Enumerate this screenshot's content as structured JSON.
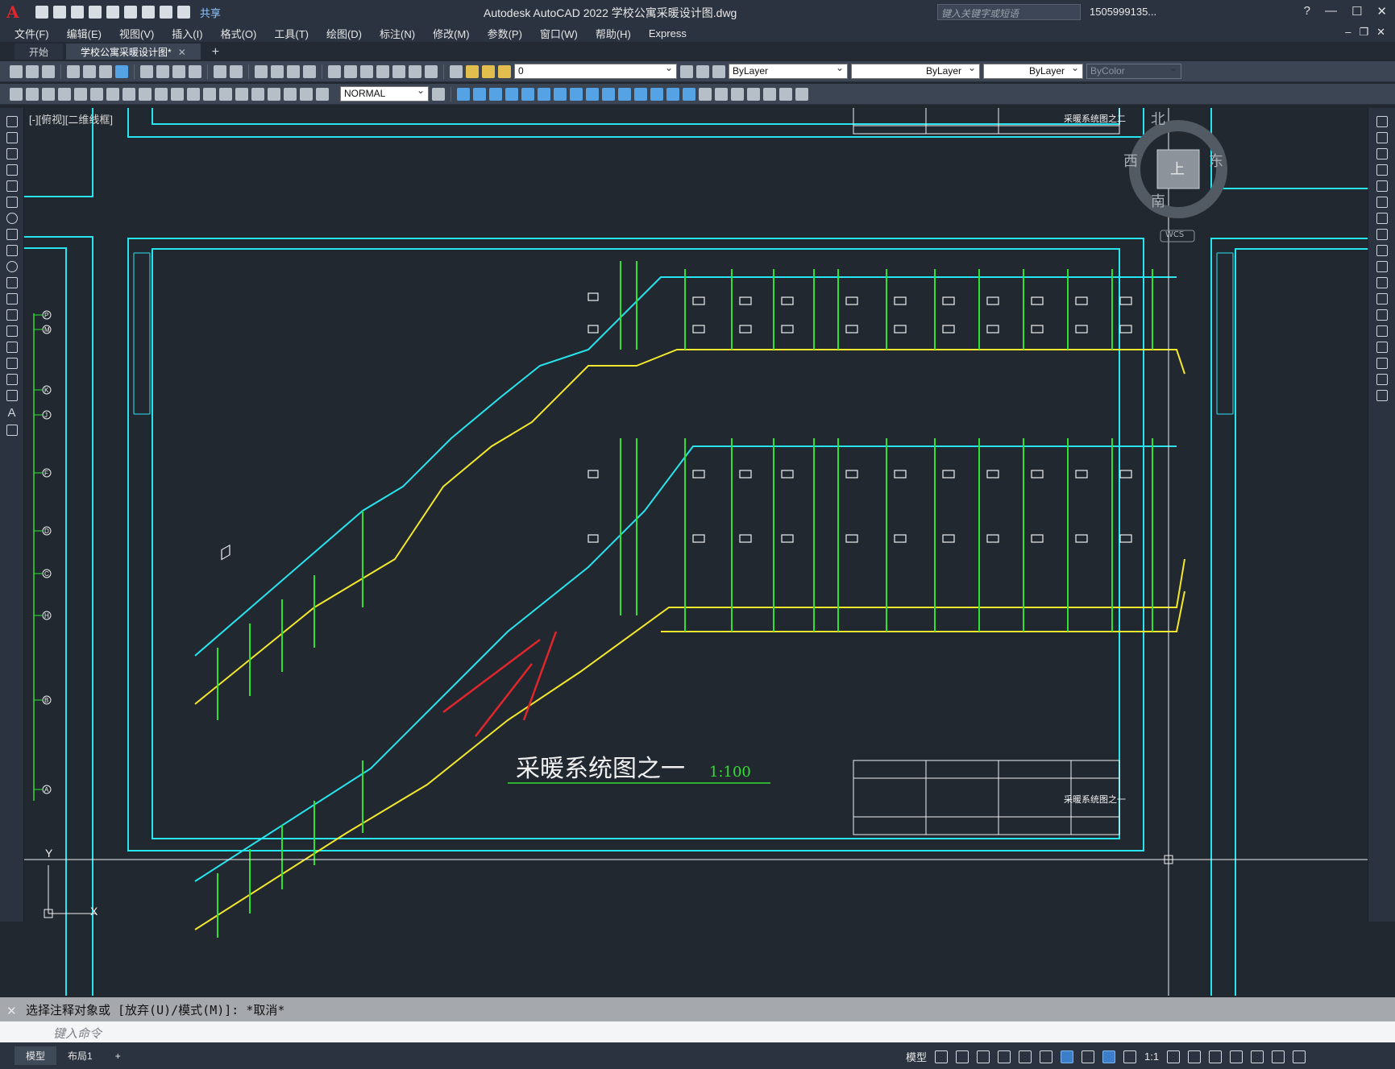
{
  "titlebar": {
    "share_label": "共享",
    "title": "Autodesk AutoCAD 2022    学校公寓采暖设计图.dwg",
    "search_placeholder": "键入关键字或短语",
    "user": "1505999135..."
  },
  "menu": [
    "文件(F)",
    "编辑(E)",
    "视图(V)",
    "插入(I)",
    "格式(O)",
    "工具(T)",
    "绘图(D)",
    "标注(N)",
    "修改(M)",
    "参数(P)",
    "窗口(W)",
    "帮助(H)",
    "Express"
  ],
  "tabs": [
    {
      "label": "开始",
      "active": false
    },
    {
      "label": "学校公寓采暖设计图*",
      "active": true
    }
  ],
  "toolbar": {
    "layer_value": "0",
    "color_value": "ByLayer",
    "linetype_value": "ByLayer",
    "lineweight_value": "ByLayer",
    "plotstyle_value": "ByColor",
    "textstyle_value": "NORMAL"
  },
  "viewport": {
    "label": "[-][俯视][二维线框]",
    "viewcube": {
      "north": "北",
      "south": "南",
      "east": "东",
      "west": "西",
      "top": "上",
      "wcs": "WCS"
    },
    "ucs_y": "Y",
    "ucs_x": "X"
  },
  "drawing": {
    "title_main": "采暖系统图之一",
    "title_scale": "1:100",
    "title_upper": "采暖系统图之二",
    "grid_labels": [
      "P",
      "M",
      "K",
      "J",
      "F",
      "D",
      "C",
      "H",
      "B",
      "A"
    ]
  },
  "command": {
    "history": "选择注释对象或 [放弃(U)/模式(M)]: *取消*",
    "placeholder": "键入命令"
  },
  "status": {
    "layout_tabs": [
      "模型",
      "布局1"
    ],
    "model_label": "模型",
    "scale": "1:1"
  },
  "colors": {
    "cyan": "#27e4ef",
    "yellow": "#f4e82c",
    "green": "#30e030",
    "red": "#e0262b",
    "white": "#f0f0f0",
    "background": "#212830"
  }
}
